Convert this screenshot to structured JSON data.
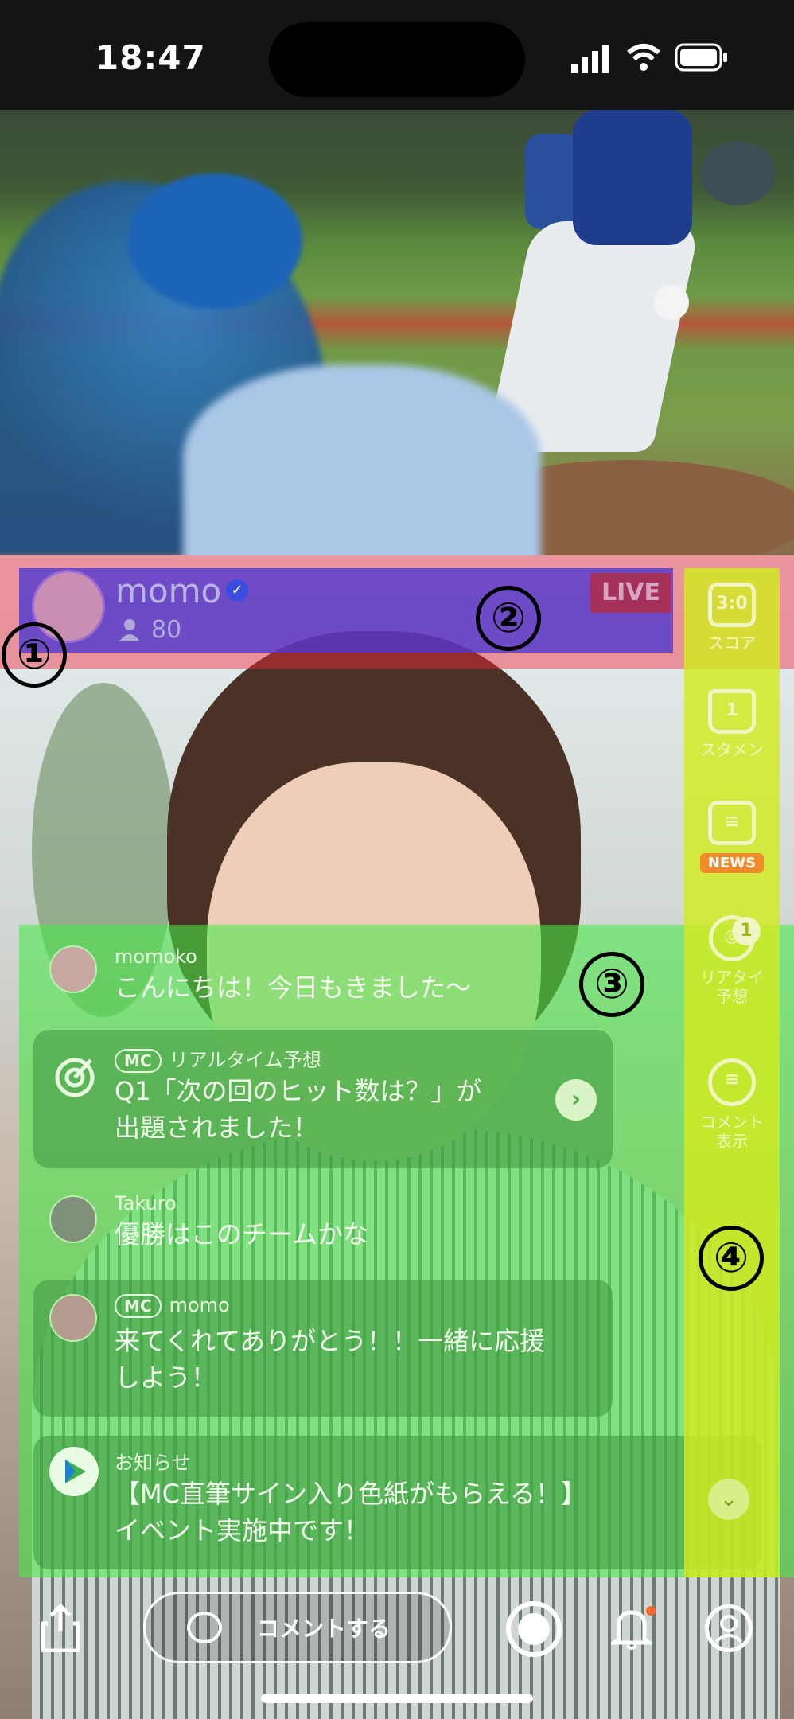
{
  "status_bar": {
    "time": "18:47"
  },
  "header": {
    "streamer_name": "momo",
    "viewer_count": "80",
    "live_label": "LIVE"
  },
  "annotations": [
    "①",
    "②",
    "③",
    "④"
  ],
  "side_menu": {
    "score": {
      "icon_text": "3:0",
      "label": "スコア"
    },
    "lineup": {
      "icon_text": "1",
      "label": "スタメン"
    },
    "news": {
      "badge": "NEWS"
    },
    "realtime": {
      "label": "リアタイ\n予想",
      "badge": "1"
    },
    "comments": {
      "label": "コメント\n表示"
    }
  },
  "chat": {
    "messages": [
      {
        "user": "momoko",
        "text": "こんにちは！今日もきました〜"
      },
      {
        "tag": "MC",
        "user": "リアルタイム予想",
        "text": "Q1「次の回のヒット数は？」が\n出題されました！"
      },
      {
        "user": "Takuro",
        "text": "優勝はこのチームかな"
      },
      {
        "tag": "MC",
        "user": "momo",
        "text": "来てくれてありがとう！！一緒に応援\nしよう！"
      },
      {
        "user": "お知らせ",
        "text": "【MC直筆サイン入り色紙がもらえる！】\nイベント実施中です！"
      }
    ]
  },
  "toolbar": {
    "comment_label": "コメントする"
  },
  "colors": {
    "red_overlay": "#f0283c",
    "blue_overlay": "#4b37d2",
    "green_overlay": "#46eb46",
    "yellow_overlay": "#d2eb1e"
  }
}
